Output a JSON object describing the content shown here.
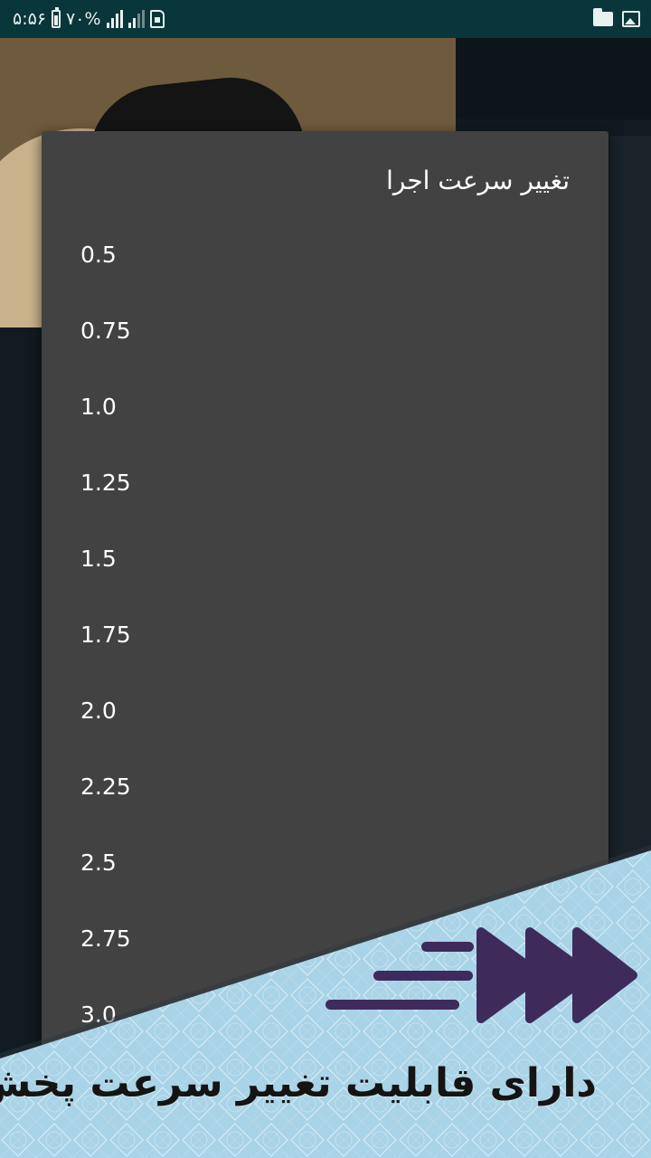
{
  "status_bar": {
    "time": "۵:۵۶",
    "battery": "۷۰%",
    "icons": [
      "battery-icon",
      "signal-icon",
      "signal-icon",
      "sim-icon",
      "folder-icon",
      "image-icon"
    ]
  },
  "dialog": {
    "title": "تغییر سرعت اجرا",
    "options": [
      "0.5",
      "0.75",
      "1.0",
      "1.25",
      "1.5",
      "1.75",
      "2.0",
      "2.25",
      "2.5",
      "2.75",
      "3.0"
    ]
  },
  "promo": {
    "caption": "دارای قابلیت تغییر سرعت پخش",
    "icon": "fast-forward-icon",
    "colors": {
      "banner": "#a9d3e6",
      "icon": "#3f2a5c"
    }
  }
}
